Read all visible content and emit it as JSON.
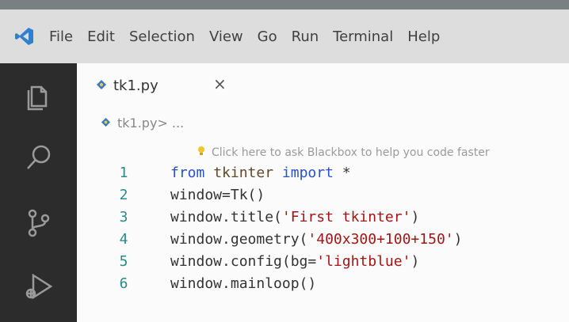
{
  "menu": [
    "File",
    "Edit",
    "Selection",
    "View",
    "Go",
    "Run",
    "Terminal",
    "Help"
  ],
  "activity_icons": [
    "explorer-icon",
    "search-icon",
    "source-control-icon",
    "run-debug-icon"
  ],
  "tab": {
    "filename": "tk1.py",
    "close_glyph": "×"
  },
  "breadcrumb": {
    "file": "tk1.py",
    "sep": " > ..."
  },
  "hint": "Click here to ask Blackbox to help you code faster",
  "code_lines": [
    {
      "num": "1",
      "text": "from tkinter import *"
    },
    {
      "num": "2",
      "text": "window=Tk()"
    },
    {
      "num": "3",
      "text": "window.title('First tkinter')"
    },
    {
      "num": "4",
      "text": "window.geometry('400x300+100+150')"
    },
    {
      "num": "5",
      "text": "window.config(bg='lightblue')"
    },
    {
      "num": "6",
      "text": "window.mainloop()"
    }
  ],
  "colors": {
    "activity_bar": "#2c2c2c",
    "menu_bar": "#dddddd",
    "vscode_blue": "#2f80d1",
    "keyword": "#2a52c6",
    "string": "#a31515",
    "line_number": "#2b8a8a"
  }
}
